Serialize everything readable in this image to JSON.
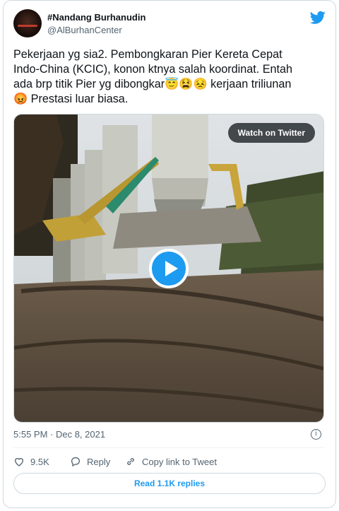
{
  "author": {
    "name": "#Nandang Burhanudin",
    "handle": "@AlBurhanCenter"
  },
  "tweet": {
    "text_line1": "Pekerjaan yg sia2. Pembongkaran Pier Kereta Cepat",
    "text_line2": "Indo-China (KCIC), konon ktnya salah koordinat. Entah",
    "text_line3_a": "ada brp titik Pier yg dibongkar",
    "text_line3_emoji": "😇😫😣",
    "text_line3_b": " kerjaan triliunan",
    "text_line4_emoji": "😡",
    "text_line4_b": " Prestasi luar biasa."
  },
  "media": {
    "watch_label": "Watch on Twitter"
  },
  "meta": {
    "timestamp": "5:55 PM · Dec 8, 2021"
  },
  "actions": {
    "likes": "9.5K",
    "reply_label": "Reply",
    "copy_link_label": "Copy link to Tweet"
  },
  "read_replies_label": "Read 1.1K replies",
  "colors": {
    "accent": "#1d9bf0",
    "secondary_text": "#536471",
    "border": "#cfd9de"
  }
}
